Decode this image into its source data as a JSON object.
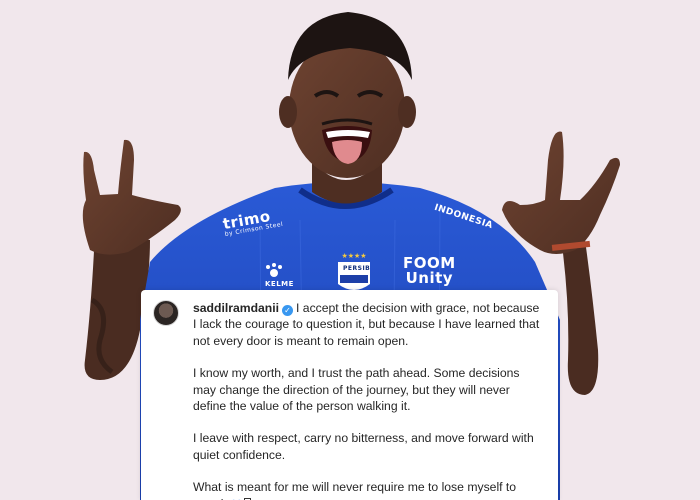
{
  "post": {
    "username": "saddilramdanii",
    "verified_icon": "verified-badge-icon",
    "paragraphs": [
      "I accept the decision with grace, not because I lack the courage to question it, but because I have learned that not every door is meant to remain open.",
      "I know my worth, and I trust the path ahead. Some decisions may change the direction of the journey, but they will never define the value of the person walking it.",
      "I leave with respect, carry no bitterness, and move forward with quiet confidence.",
      "What is meant for me will never require me to lose myself to earn it."
    ],
    "trailing_icons": [
      "blue-heart-icon",
      "missing-glyph-icon"
    ]
  },
  "photo": {
    "jersey_sponsor": "trimo",
    "jersey_sponsor_sub": "by Crimson Steel",
    "jersey_brand": "KELME",
    "jersey_sleeve": "INDONESIA",
    "jersey_sponsor_2": "FOOM",
    "jersey_sponsor_2_line2": "Unity",
    "crest_label": "PERSIB"
  },
  "colors": {
    "background": "#f1e7ec",
    "jersey_blue": "#1f4fc7",
    "verified_blue": "#3897f0",
    "heart_blue": "#3b82f6"
  }
}
